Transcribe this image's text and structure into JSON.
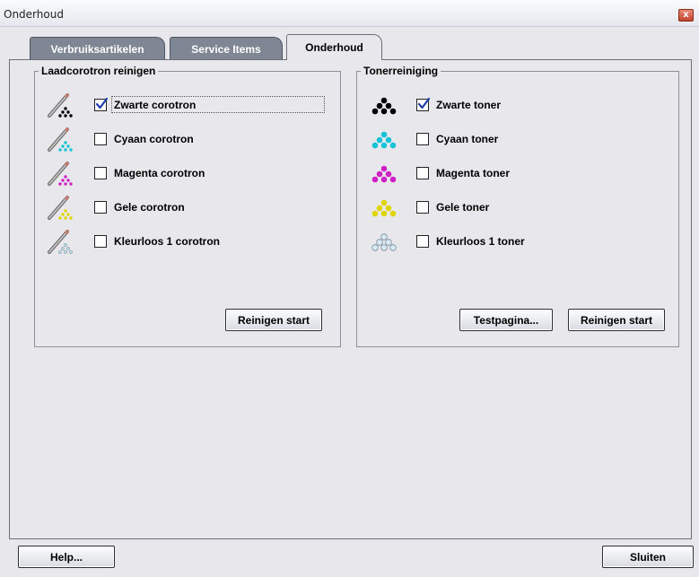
{
  "window": {
    "title": "Onderhoud",
    "close_glyph": "x"
  },
  "tabs": [
    {
      "label": "Verbruiksartikelen"
    },
    {
      "label": "Service Items"
    },
    {
      "label": "Onderhoud",
      "active": true
    }
  ],
  "corotron_group": {
    "title": "Laadcorotron reinigen",
    "items": [
      {
        "label": "Zwarte corotron",
        "checked": true,
        "color": "#000000"
      },
      {
        "label": "Cyaan corotron",
        "checked": false,
        "color": "#17c3d6"
      },
      {
        "label": "Magenta corotron",
        "checked": false,
        "color": "#d11fc6"
      },
      {
        "label": "Gele corotron",
        "checked": false,
        "color": "#e0d400"
      },
      {
        "label": "Kleurloos 1 corotron",
        "checked": false,
        "color": "#b9dde6"
      }
    ],
    "start_button": "Reinigen start"
  },
  "toner_group": {
    "title": "Tonerreiniging",
    "items": [
      {
        "label": "Zwarte toner",
        "checked": true,
        "color": "#000000"
      },
      {
        "label": "Cyaan toner",
        "checked": false,
        "color": "#17c3d6"
      },
      {
        "label": "Magenta toner",
        "checked": false,
        "color": "#d11fc6"
      },
      {
        "label": "Gele toner",
        "checked": false,
        "color": "#e0d400"
      },
      {
        "label": "Kleurloos 1 toner",
        "checked": false,
        "color": "#d6ecf2"
      }
    ],
    "test_button": "Testpagina...",
    "start_button": "Reinigen start"
  },
  "footer": {
    "help_button": "Help...",
    "close_button": "Sluiten"
  },
  "icons": {
    "corotron": "corotron-wand-icon",
    "toner": "toner-dots-icon",
    "close": "close-icon",
    "check": "checkmark-icon"
  }
}
